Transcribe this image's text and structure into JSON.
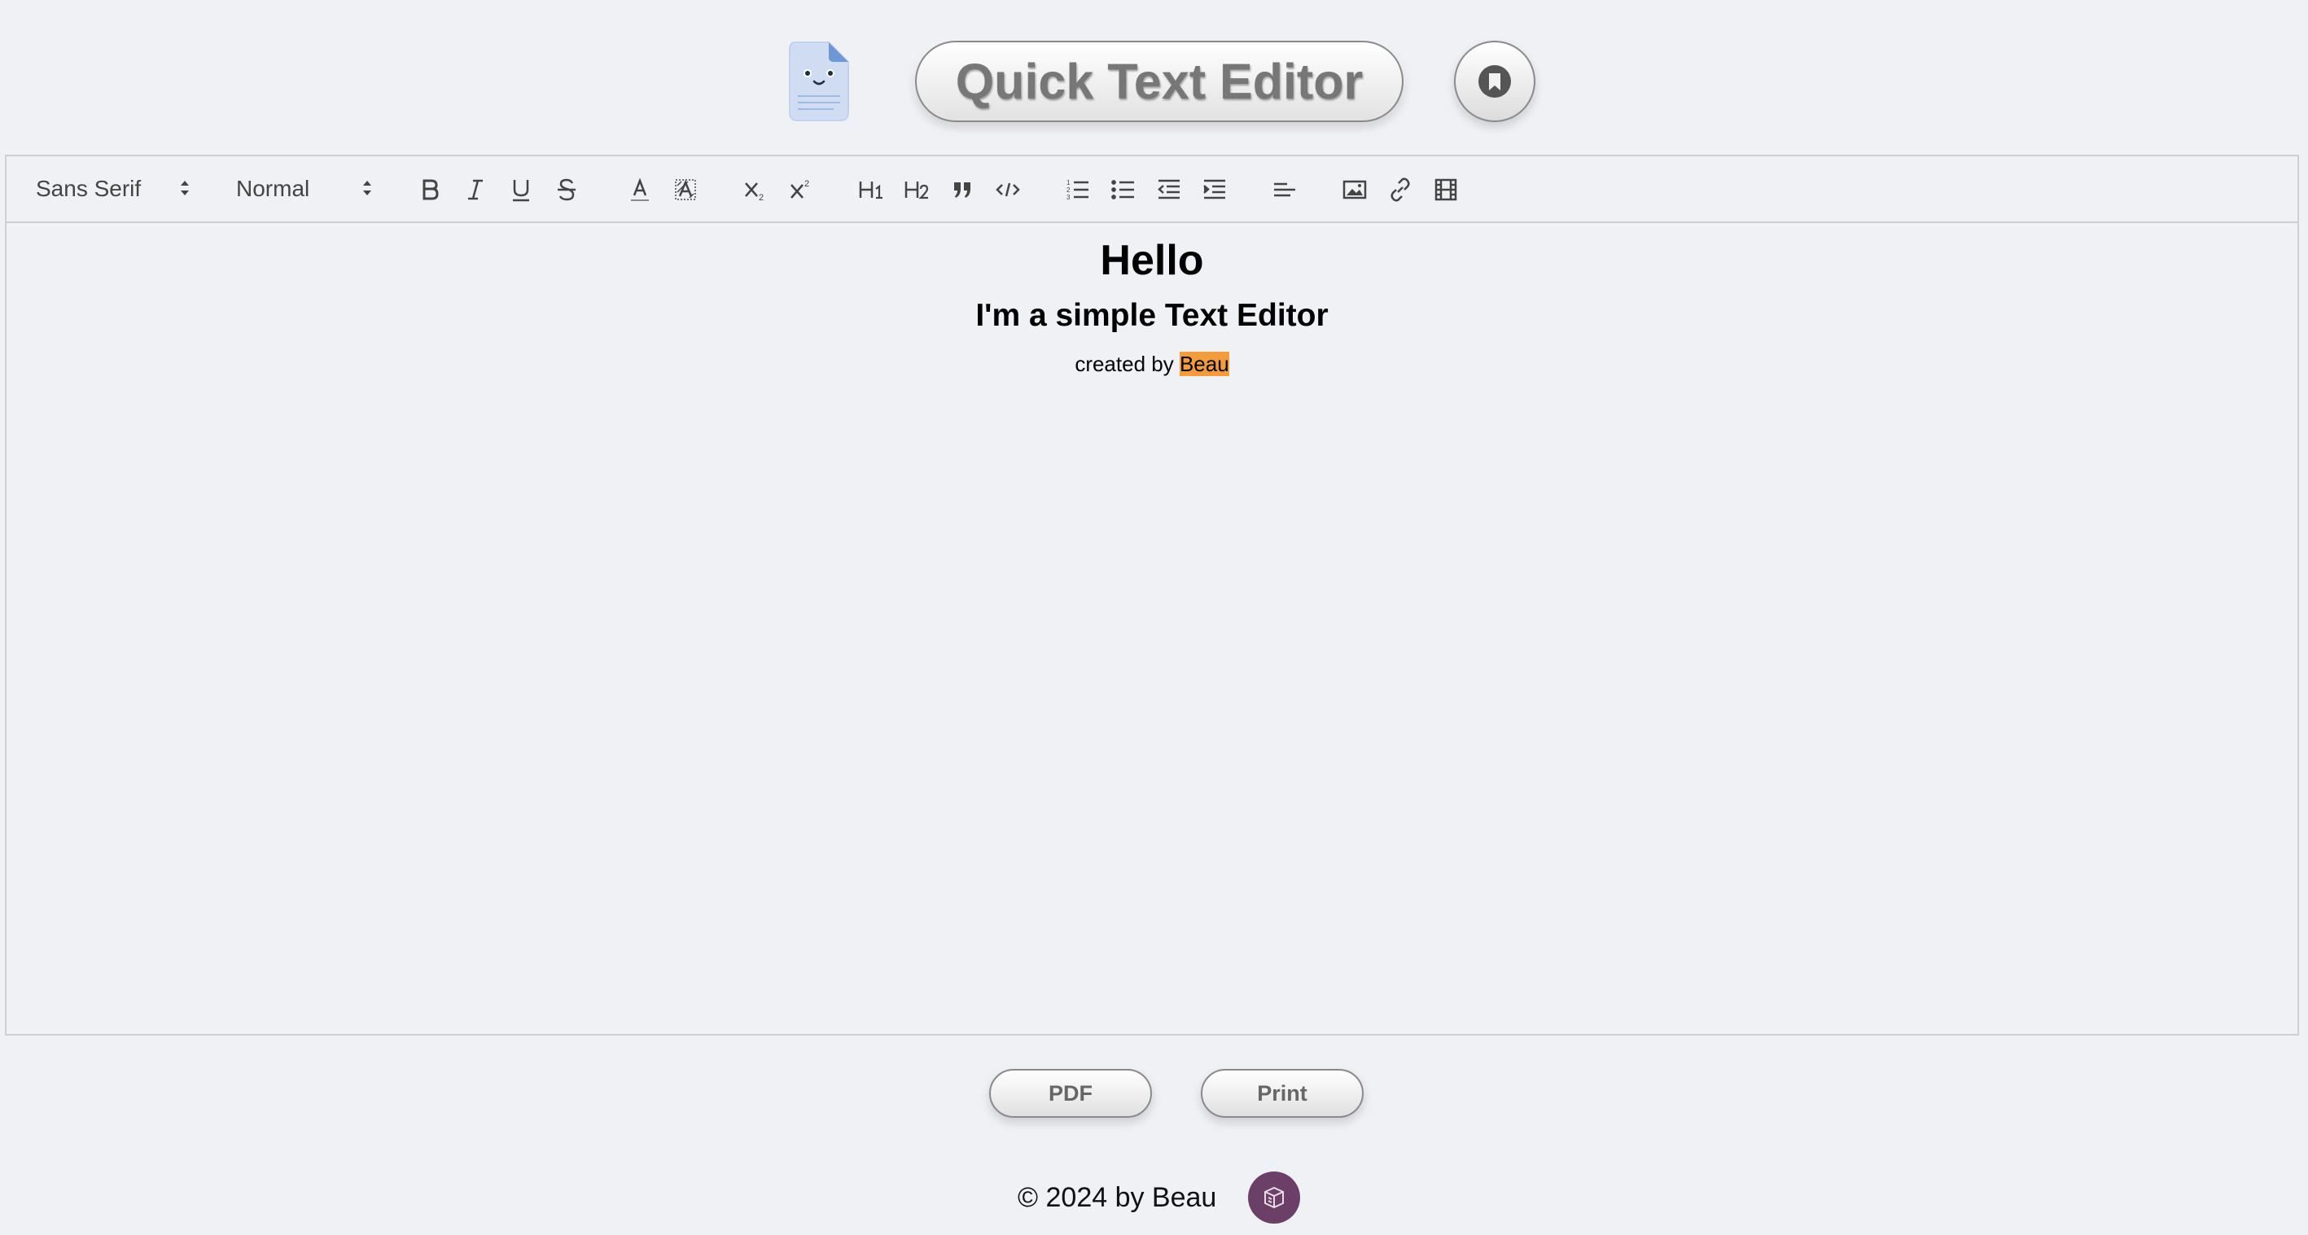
{
  "header": {
    "title": "Quick Text Editor"
  },
  "toolbar": {
    "font_picker": "Sans Serif",
    "size_picker": "Normal",
    "buttons": [
      {
        "name": "bold-icon"
      },
      {
        "name": "italic-icon"
      },
      {
        "name": "underline-icon"
      },
      {
        "name": "strikethrough-icon"
      },
      {
        "name": "text-color-icon"
      },
      {
        "name": "background-color-icon"
      },
      {
        "name": "subscript-icon"
      },
      {
        "name": "superscript-icon"
      },
      {
        "name": "heading1-icon"
      },
      {
        "name": "heading2-icon"
      },
      {
        "name": "blockquote-icon"
      },
      {
        "name": "code-block-icon"
      },
      {
        "name": "ordered-list-icon"
      },
      {
        "name": "bullet-list-icon"
      },
      {
        "name": "outdent-icon"
      },
      {
        "name": "indent-icon"
      },
      {
        "name": "align-icon"
      },
      {
        "name": "image-icon"
      },
      {
        "name": "link-icon"
      },
      {
        "name": "video-icon"
      }
    ]
  },
  "content": {
    "heading1": "Hello",
    "heading2": "I'm a simple Text Editor",
    "paragraph_prefix": "created by ",
    "highlighted_text": "Beau",
    "highlight_color": "#f39c3c"
  },
  "actions": {
    "pdf_label": "PDF",
    "print_label": "Print"
  },
  "footer": {
    "copyright": "© 2024 by Beau",
    "badge_color": "#6b3f68"
  },
  "colors": {
    "background": "#f0f1f5",
    "logo_accent": "#6f97d6"
  }
}
